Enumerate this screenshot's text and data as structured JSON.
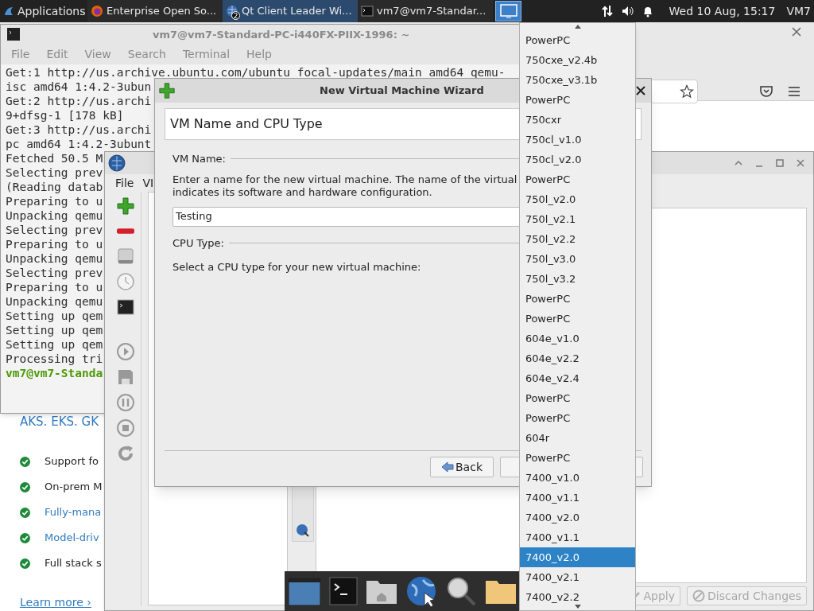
{
  "top_panel": {
    "applications": "Applications",
    "tasks": [
      {
        "kind": "firefox",
        "label": "Enterprise Open So...",
        "selected": false
      },
      {
        "kind": "qt",
        "label": "Qt Client Leader Wi...",
        "badge": "2",
        "selected": true
      },
      {
        "kind": "terminal",
        "label": "vm7@vm7-Standar...",
        "selected": false
      }
    ],
    "switcher": {
      "selected": true
    },
    "clock": "Wed 10 Aug, 15:17",
    "user": "VM7"
  },
  "browser": {
    "heading": "AKS. EKS. GK",
    "features": [
      {
        "text": "Support fo",
        "link": false
      },
      {
        "text": "On-prem M",
        "link": false
      },
      {
        "text": "Fully-mana",
        "link": true
      },
      {
        "text": "Model-driv",
        "link": true
      },
      {
        "text": "Full stack s",
        "link": false
      }
    ],
    "learn_more": "Learn more ›"
  },
  "terminal": {
    "title": "vm7@vm7-Standard-PC-i440FX-PIIX-1996: ~",
    "menu": [
      "File",
      "Edit",
      "View",
      "Search",
      "Terminal",
      "Help"
    ],
    "lines": [
      {
        "kind": "output",
        "text": "Get:1 http://us.archive.ubuntu.com/ubuntu focal-updates/main amd64 qemu-"
      },
      {
        "kind": "output",
        "text": "isc amd64 1:4.2-3ubun"
      },
      {
        "kind": "output",
        "text": "Get:2 http://us.archi"
      },
      {
        "kind": "output",
        "text": "9+dfsg-1 [178 kB]"
      },
      {
        "kind": "output",
        "text": "Get:3 http://us.archi"
      },
      {
        "kind": "output",
        "text": "pc amd64 1:4.2-3ubunt"
      },
      {
        "kind": "output",
        "text": "Fetched 50.5 M"
      },
      {
        "kind": "output",
        "text": "Selecting prev"
      },
      {
        "kind": "output",
        "text": "(Reading datab"
      },
      {
        "kind": "output",
        "text": "Preparing to u"
      },
      {
        "kind": "output",
        "text": "Unpacking qemu"
      },
      {
        "kind": "output",
        "text": "Selecting prev"
      },
      {
        "kind": "output",
        "text": "Preparing to u"
      },
      {
        "kind": "output",
        "text": "Unpacking qemu"
      },
      {
        "kind": "output",
        "text": "Selecting prev"
      },
      {
        "kind": "output",
        "text": "Preparing to u"
      },
      {
        "kind": "output",
        "text": "Unpacking qemu"
      },
      {
        "kind": "output",
        "text": "Setting up qem"
      },
      {
        "kind": "output",
        "text": "Setting up qem"
      },
      {
        "kind": "output",
        "text": "Setting up qem"
      },
      {
        "kind": "output",
        "text": "Processing tri"
      },
      {
        "kind": "prompt",
        "text": "vm7@vm7-Standa"
      }
    ]
  },
  "virt_manager": {
    "menu": [
      "File",
      "VI"
    ],
    "buttons": [
      {
        "label": "Apply",
        "kind": "apply",
        "disabled": true
      },
      {
        "label": "Discard Changes",
        "kind": "discard",
        "disabled": true
      }
    ]
  },
  "wizard": {
    "title": "New Virtual Machine Wizard",
    "header": "VM Name and CPU Type",
    "vm_name_label": "VM Name:",
    "description": [
      "Enter a name for the new virtual machine. The name of the virtual",
      "indicates its software and hardware configuration."
    ],
    "name_value": "Testing",
    "cpu_label": "CPU Type:",
    "cpu_prompt": "Select a CPU type for your new virtual machine:",
    "back": "Back"
  },
  "dropdown": {
    "items": [
      {
        "label": "PowerPC",
        "selected": false
      },
      {
        "label": "750cxe_v2.4b",
        "selected": false
      },
      {
        "label": "750cxe_v3.1b",
        "selected": false
      },
      {
        "label": "PowerPC",
        "selected": false
      },
      {
        "label": "750cxr",
        "selected": false
      },
      {
        "label": "750cl_v1.0",
        "selected": false
      },
      {
        "label": "750cl_v2.0",
        "selected": false
      },
      {
        "label": "PowerPC",
        "selected": false
      },
      {
        "label": "750l_v2.0",
        "selected": false
      },
      {
        "label": "750l_v2.1",
        "selected": false
      },
      {
        "label": "750l_v2.2",
        "selected": false
      },
      {
        "label": "750l_v3.0",
        "selected": false
      },
      {
        "label": "750l_v3.2",
        "selected": false
      },
      {
        "label": "PowerPC",
        "selected": false
      },
      {
        "label": "PowerPC",
        "selected": false
      },
      {
        "label": "604e_v1.0",
        "selected": false
      },
      {
        "label": "604e_v2.2",
        "selected": false
      },
      {
        "label": "604e_v2.4",
        "selected": false
      },
      {
        "label": "PowerPC",
        "selected": false
      },
      {
        "label": "PowerPC",
        "selected": false
      },
      {
        "label": "604r",
        "selected": false
      },
      {
        "label": "PowerPC",
        "selected": false
      },
      {
        "label": "7400_v1.0",
        "selected": false
      },
      {
        "label": "7400_v1.1",
        "selected": false
      },
      {
        "label": "7400_v2.0",
        "selected": false
      },
      {
        "label": "7400_v1.1",
        "selected": false
      },
      {
        "label": "7400_v2.0",
        "selected": true
      },
      {
        "label": "7400_v2.1",
        "selected": false
      },
      {
        "label": "7400_v2.2",
        "selected": false
      }
    ]
  }
}
